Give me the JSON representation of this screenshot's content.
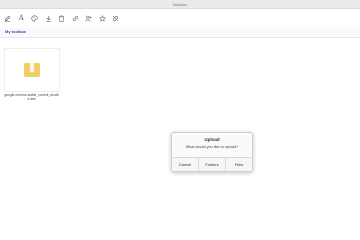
{
  "window": {
    "title": "Nautilus"
  },
  "toolbar": {
    "buttons": [
      {
        "icon": "edit-icon"
      },
      {
        "icon": "text-icon",
        "glyph": "A"
      },
      {
        "icon": "palette-icon"
      },
      {
        "icon": "download-icon"
      },
      {
        "icon": "trash-icon"
      },
      {
        "icon": "link-icon"
      },
      {
        "icon": "add-user-icon"
      },
      {
        "icon": "star-icon"
      },
      {
        "icon": "unlink-icon"
      }
    ]
  },
  "breadcrumb": {
    "label": "My toolbox"
  },
  "files": [
    {
      "name": "google-chrome-stable_current_amd64.deb",
      "icon": "package-icon"
    }
  ],
  "dialog": {
    "title": "Upload",
    "message": "What would you like to upload?",
    "cancel_label": "Cancel",
    "folders_label": "Folders",
    "files_label": "Files"
  }
}
